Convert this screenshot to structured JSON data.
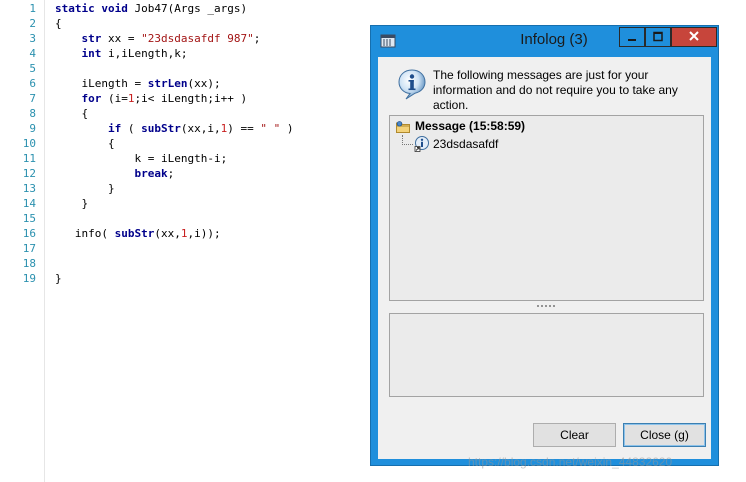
{
  "editor": {
    "lines": [
      {
        "n": "1",
        "tokens": [
          {
            "t": "static void",
            "c": "k"
          },
          {
            "t": " Job47(Args _args)"
          }
        ]
      },
      {
        "n": "2",
        "tokens": [
          {
            "t": "{"
          }
        ]
      },
      {
        "n": "3",
        "tokens": [
          {
            "t": "    "
          },
          {
            "t": "str",
            "c": "k"
          },
          {
            "t": " xx = "
          },
          {
            "t": "\"23dsdasafdf 987\"",
            "c": "s"
          },
          {
            "t": ";"
          }
        ]
      },
      {
        "n": "4",
        "tokens": [
          {
            "t": "    "
          },
          {
            "t": "int",
            "c": "k"
          },
          {
            "t": " i,iLength,k;"
          }
        ]
      },
      {
        "n": "5",
        "tokens": []
      },
      {
        "n": "6",
        "tokens": [
          {
            "t": "    iLength = "
          },
          {
            "t": "strLen",
            "c": "k"
          },
          {
            "t": "(xx);"
          }
        ]
      },
      {
        "n": "7",
        "tokens": [
          {
            "t": "    "
          },
          {
            "t": "for",
            "c": "kw"
          },
          {
            "t": " (i="
          },
          {
            "t": "1",
            "c": "n"
          },
          {
            "t": ";i< iLength;i++ )"
          }
        ]
      },
      {
        "n": "8",
        "tokens": [
          {
            "t": "    {"
          }
        ]
      },
      {
        "n": "9",
        "tokens": [
          {
            "t": "        "
          },
          {
            "t": "if",
            "c": "kw"
          },
          {
            "t": " ( "
          },
          {
            "t": "subStr",
            "c": "k"
          },
          {
            "t": "(xx,i,"
          },
          {
            "t": "1",
            "c": "n"
          },
          {
            "t": ") == "
          },
          {
            "t": "\" \"",
            "c": "s"
          },
          {
            "t": " )"
          }
        ]
      },
      {
        "n": "10",
        "tokens": [
          {
            "t": "        {"
          }
        ]
      },
      {
        "n": "11",
        "tokens": [
          {
            "t": "            k = iLength-i;"
          }
        ]
      },
      {
        "n": "12",
        "tokens": [
          {
            "t": "            "
          },
          {
            "t": "break",
            "c": "kw"
          },
          {
            "t": ";"
          }
        ]
      },
      {
        "n": "13",
        "tokens": [
          {
            "t": "        }"
          }
        ]
      },
      {
        "n": "14",
        "tokens": [
          {
            "t": "    }"
          }
        ]
      },
      {
        "n": "15",
        "tokens": []
      },
      {
        "n": "16",
        "tokens": [
          {
            "t": "   info( "
          },
          {
            "t": "subStr",
            "c": "k"
          },
          {
            "t": "(xx,"
          },
          {
            "t": "1",
            "c": "n"
          },
          {
            "t": ",i));"
          }
        ]
      },
      {
        "n": "17",
        "tokens": []
      },
      {
        "n": "18",
        "tokens": []
      },
      {
        "n": "19",
        "tokens": [
          {
            "t": "}"
          }
        ]
      }
    ]
  },
  "dialog": {
    "title": "Infolog (3)",
    "message": "The following messages are just for your information and do not require you to take any action.",
    "tree": {
      "root_label": "Message (15:58:59)",
      "child_label": "23dsdasafdf"
    },
    "buttons": {
      "clear": "Clear",
      "close": "Close (g)"
    },
    "icons": {
      "app": "infolog-app-icon",
      "info": "info-icon",
      "folder": "message-folder-icon",
      "child_info": "info-item-icon"
    }
  },
  "watermark": "https://blog.csdn.net/weixin_44832620",
  "colors": {
    "titlebar": "#1f8fdc",
    "close_button": "#c7453b",
    "keyword": "#00008b",
    "string": "#a31515",
    "number": "#c81e1e",
    "line_number": "#2b91af"
  }
}
